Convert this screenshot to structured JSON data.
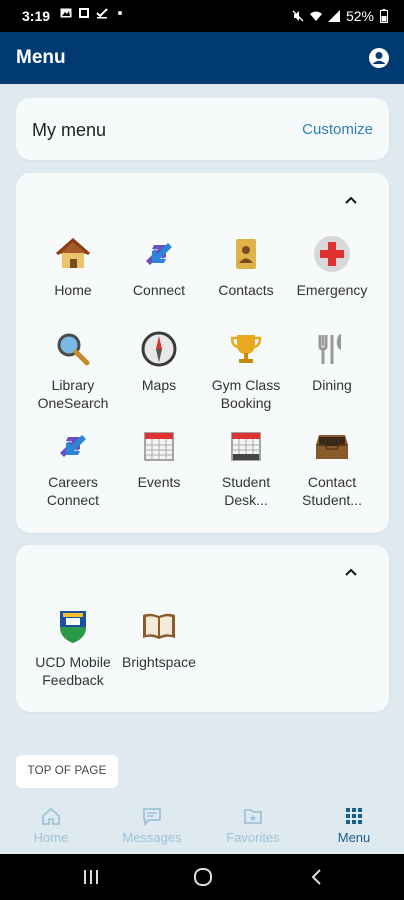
{
  "status_bar": {
    "time": "3:19",
    "battery": "52%"
  },
  "header": {
    "title": "Menu"
  },
  "my_menu": {
    "label": "My menu",
    "customize": "Customize"
  },
  "section1": {
    "items": [
      {
        "label": "Home",
        "icon": "home-icon"
      },
      {
        "label": "Connect",
        "icon": "connect-icon"
      },
      {
        "label": "Contacts",
        "icon": "contacts-icon"
      },
      {
        "label": "Emergency",
        "icon": "emergency-icon"
      },
      {
        "label": "Library OneSearch",
        "icon": "magnifier-icon"
      },
      {
        "label": "Maps",
        "icon": "compass-icon"
      },
      {
        "label": "Gym Class Booking",
        "icon": "trophy-icon"
      },
      {
        "label": "Dining",
        "icon": "cutlery-icon"
      },
      {
        "label": "Careers Connect",
        "icon": "connect-icon"
      },
      {
        "label": "Events",
        "icon": "calendar-icon"
      },
      {
        "label": "Student Desk...",
        "icon": "calendar-icon"
      },
      {
        "label": "Contact Student...",
        "icon": "inbox-tray-icon"
      }
    ]
  },
  "section2": {
    "items": [
      {
        "label": "UCD Mobile Feedback",
        "icon": "ucd-crest-icon"
      },
      {
        "label": "Brightspace",
        "icon": "book-icon"
      }
    ]
  },
  "top_of_page": "TOP OF PAGE",
  "tab_bar": {
    "tabs": [
      {
        "label": "Home"
      },
      {
        "label": "Messages"
      },
      {
        "label": "Favorites"
      },
      {
        "label": "Menu"
      }
    ]
  },
  "colors": {
    "header_bg": "#003a70",
    "accent": "#2c7fb0",
    "page_bg": "#dfe9f0"
  }
}
